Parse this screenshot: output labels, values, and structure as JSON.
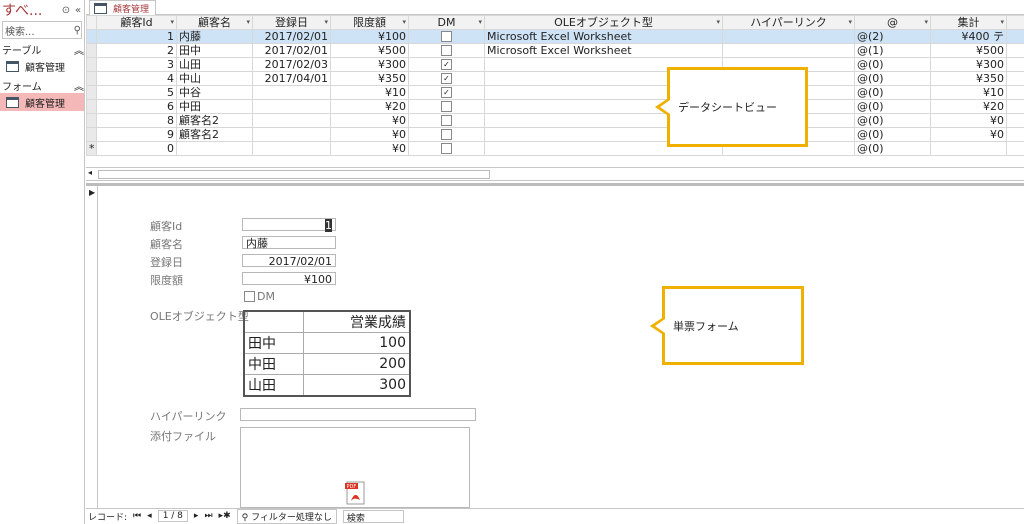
{
  "nav": {
    "title": "すべ...",
    "search_placeholder": "検索...",
    "groups": [
      {
        "label": "テーブル",
        "items": [
          {
            "label": "顧客管理"
          }
        ]
      },
      {
        "label": "フォーム",
        "items": [
          {
            "label": "顧客管理"
          }
        ]
      }
    ]
  },
  "tab": {
    "label": "顧客管理"
  },
  "datasheet": {
    "columns": [
      "顧客Id",
      "顧客名",
      "登録日",
      "限度額",
      "DM",
      "OLEオブジェクト型",
      "ハイパーリンク",
      "",
      "集計"
    ],
    "rows": [
      {
        "id": "1",
        "name": "内藤",
        "date": "2017/02/01",
        "limit": "¥100",
        "dm": false,
        "ole": "Microsoft Excel Worksheet",
        "link": "",
        "att": "(2)",
        "total": "¥400 テ"
      },
      {
        "id": "2",
        "name": "田中",
        "date": "2017/02/01",
        "limit": "¥500",
        "dm": false,
        "ole": "Microsoft Excel Worksheet",
        "link": "",
        "att": "(1)",
        "total": "¥500"
      },
      {
        "id": "3",
        "name": "山田",
        "date": "2017/02/03",
        "limit": "¥300",
        "dm": true,
        "ole": "",
        "link": "",
        "att": "(0)",
        "total": "¥300"
      },
      {
        "id": "4",
        "name": "中山",
        "date": "2017/04/01",
        "limit": "¥350",
        "dm": true,
        "ole": "",
        "link": "",
        "att": "(0)",
        "total": "¥350"
      },
      {
        "id": "5",
        "name": "中谷",
        "date": "",
        "limit": "¥10",
        "dm": true,
        "ole": "",
        "link": "",
        "att": "(0)",
        "total": "¥10"
      },
      {
        "id": "6",
        "name": "中田",
        "date": "",
        "limit": "¥20",
        "dm": false,
        "ole": "",
        "link": "",
        "att": "(0)",
        "total": "¥20"
      },
      {
        "id": "8",
        "name": "顧客名2",
        "date": "",
        "limit": "¥0",
        "dm": false,
        "ole": "",
        "link": "",
        "att": "(0)",
        "total": "¥0"
      },
      {
        "id": "9",
        "name": "顧客名2",
        "date": "",
        "limit": "¥0",
        "dm": false,
        "ole": "",
        "link": "",
        "att": "(0)",
        "total": "¥0"
      },
      {
        "id": "0",
        "name": "",
        "date": "",
        "limit": "¥0",
        "dm": false,
        "ole": "",
        "link": "",
        "att": "(0)",
        "total": ""
      }
    ]
  },
  "callout_datasheet": "データシートビュー",
  "callout_form": "単票フォーム",
  "form": {
    "id_label": "顧客Id",
    "id_value": "1",
    "name_label": "顧客名",
    "name_value": "内藤",
    "date_label": "登録日",
    "date_value": "2017/02/01",
    "limit_label": "限度額",
    "limit_value": "¥100",
    "dm_label": "DM",
    "ole_label": "OLEオブジェクト型",
    "ole_table": {
      "header": [
        "",
        "営業成績"
      ],
      "rows": [
        [
          "田中",
          "100"
        ],
        [
          "中田",
          "200"
        ],
        [
          "山田",
          "300"
        ]
      ]
    },
    "link_label": "ハイパーリンク",
    "attach_label": "添付ファイル",
    "pdf_icon": "pdf-file-icon"
  },
  "status": {
    "record_label": "レコード:",
    "record_pos": "1 / 8",
    "filter": "フィルター処理なし",
    "search": "検索"
  }
}
